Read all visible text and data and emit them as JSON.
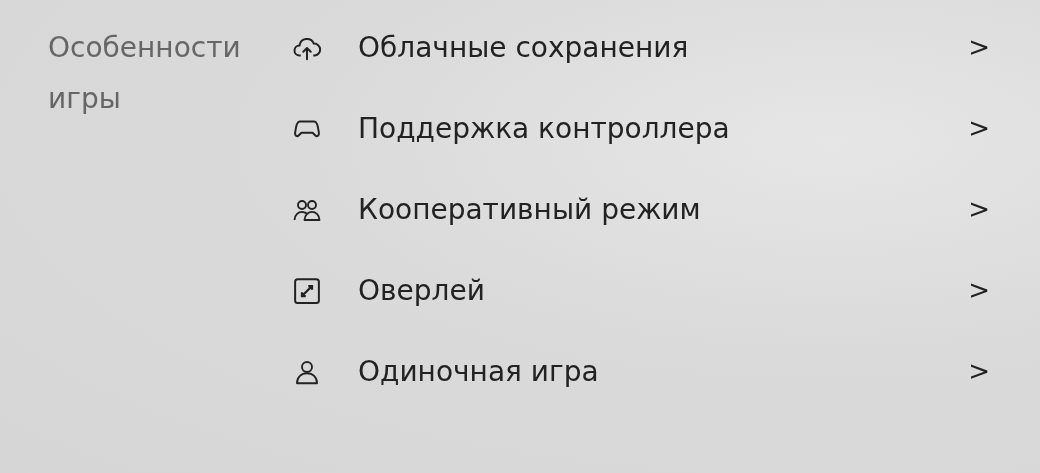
{
  "section": {
    "title": "Особенности игры",
    "features": [
      {
        "label": "Облачные сохранения",
        "chevron": ">"
      },
      {
        "label": "Поддержка контроллера",
        "chevron": ">"
      },
      {
        "label": "Кооперативный режим",
        "chevron": ">"
      },
      {
        "label": "Оверлей",
        "chevron": ">"
      },
      {
        "label": "Одиночная игра",
        "chevron": ">"
      }
    ]
  }
}
